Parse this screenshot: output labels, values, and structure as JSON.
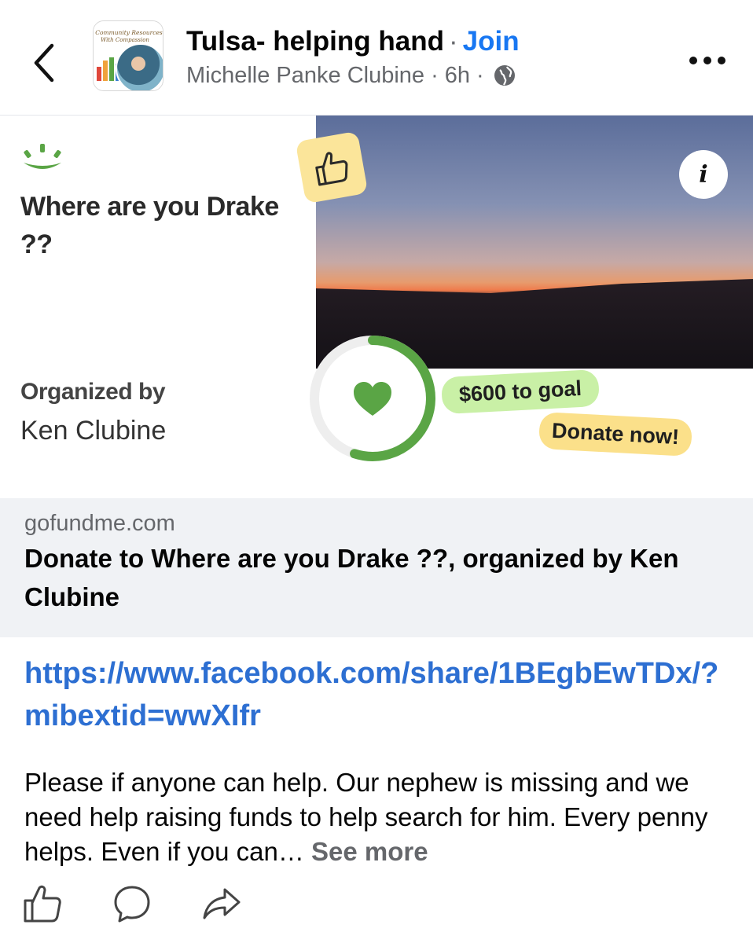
{
  "header": {
    "group_name": "Tulsa- helping hand",
    "separator": "·",
    "join_label": "Join",
    "author": "Michelle Panke Clubine",
    "time": "6h",
    "avatar_text": "Community Resources With Compassion"
  },
  "preview": {
    "campaign_title": "Where are you Drake ??",
    "organized_label": "Organized by",
    "organizer_name": "Ken Clubine",
    "goal_label": "$600 to goal",
    "donate_label": "Donate now!",
    "info_label": "i",
    "progress": 0.55,
    "domain": "gofundme.com",
    "link_title": "Donate to Where are you Drake ??, organized by Ken Clubine"
  },
  "post": {
    "link": "https://www.facebook.com/share/1BEgbEwTDx/?mibextid=wwXIfr",
    "text": "Please if anyone can help.   Our nephew is missing and we need help raising funds to help search for him.   Every penny helps.  Even if you can… ",
    "see_more": "See more"
  },
  "colors": {
    "join": "#1877f2",
    "link": "#2d6fd2",
    "gofundme_green": "#5aa545",
    "goal_pill": "#c9f0a6",
    "donate_pill": "#fbe08a"
  },
  "icons": [
    "back-arrow-icon",
    "globe-icon",
    "more-dots-icon",
    "gofundme-logo-icon",
    "thumbs-up-icon",
    "info-icon",
    "heart-icon",
    "like-icon",
    "comment-icon",
    "share-icon"
  ]
}
